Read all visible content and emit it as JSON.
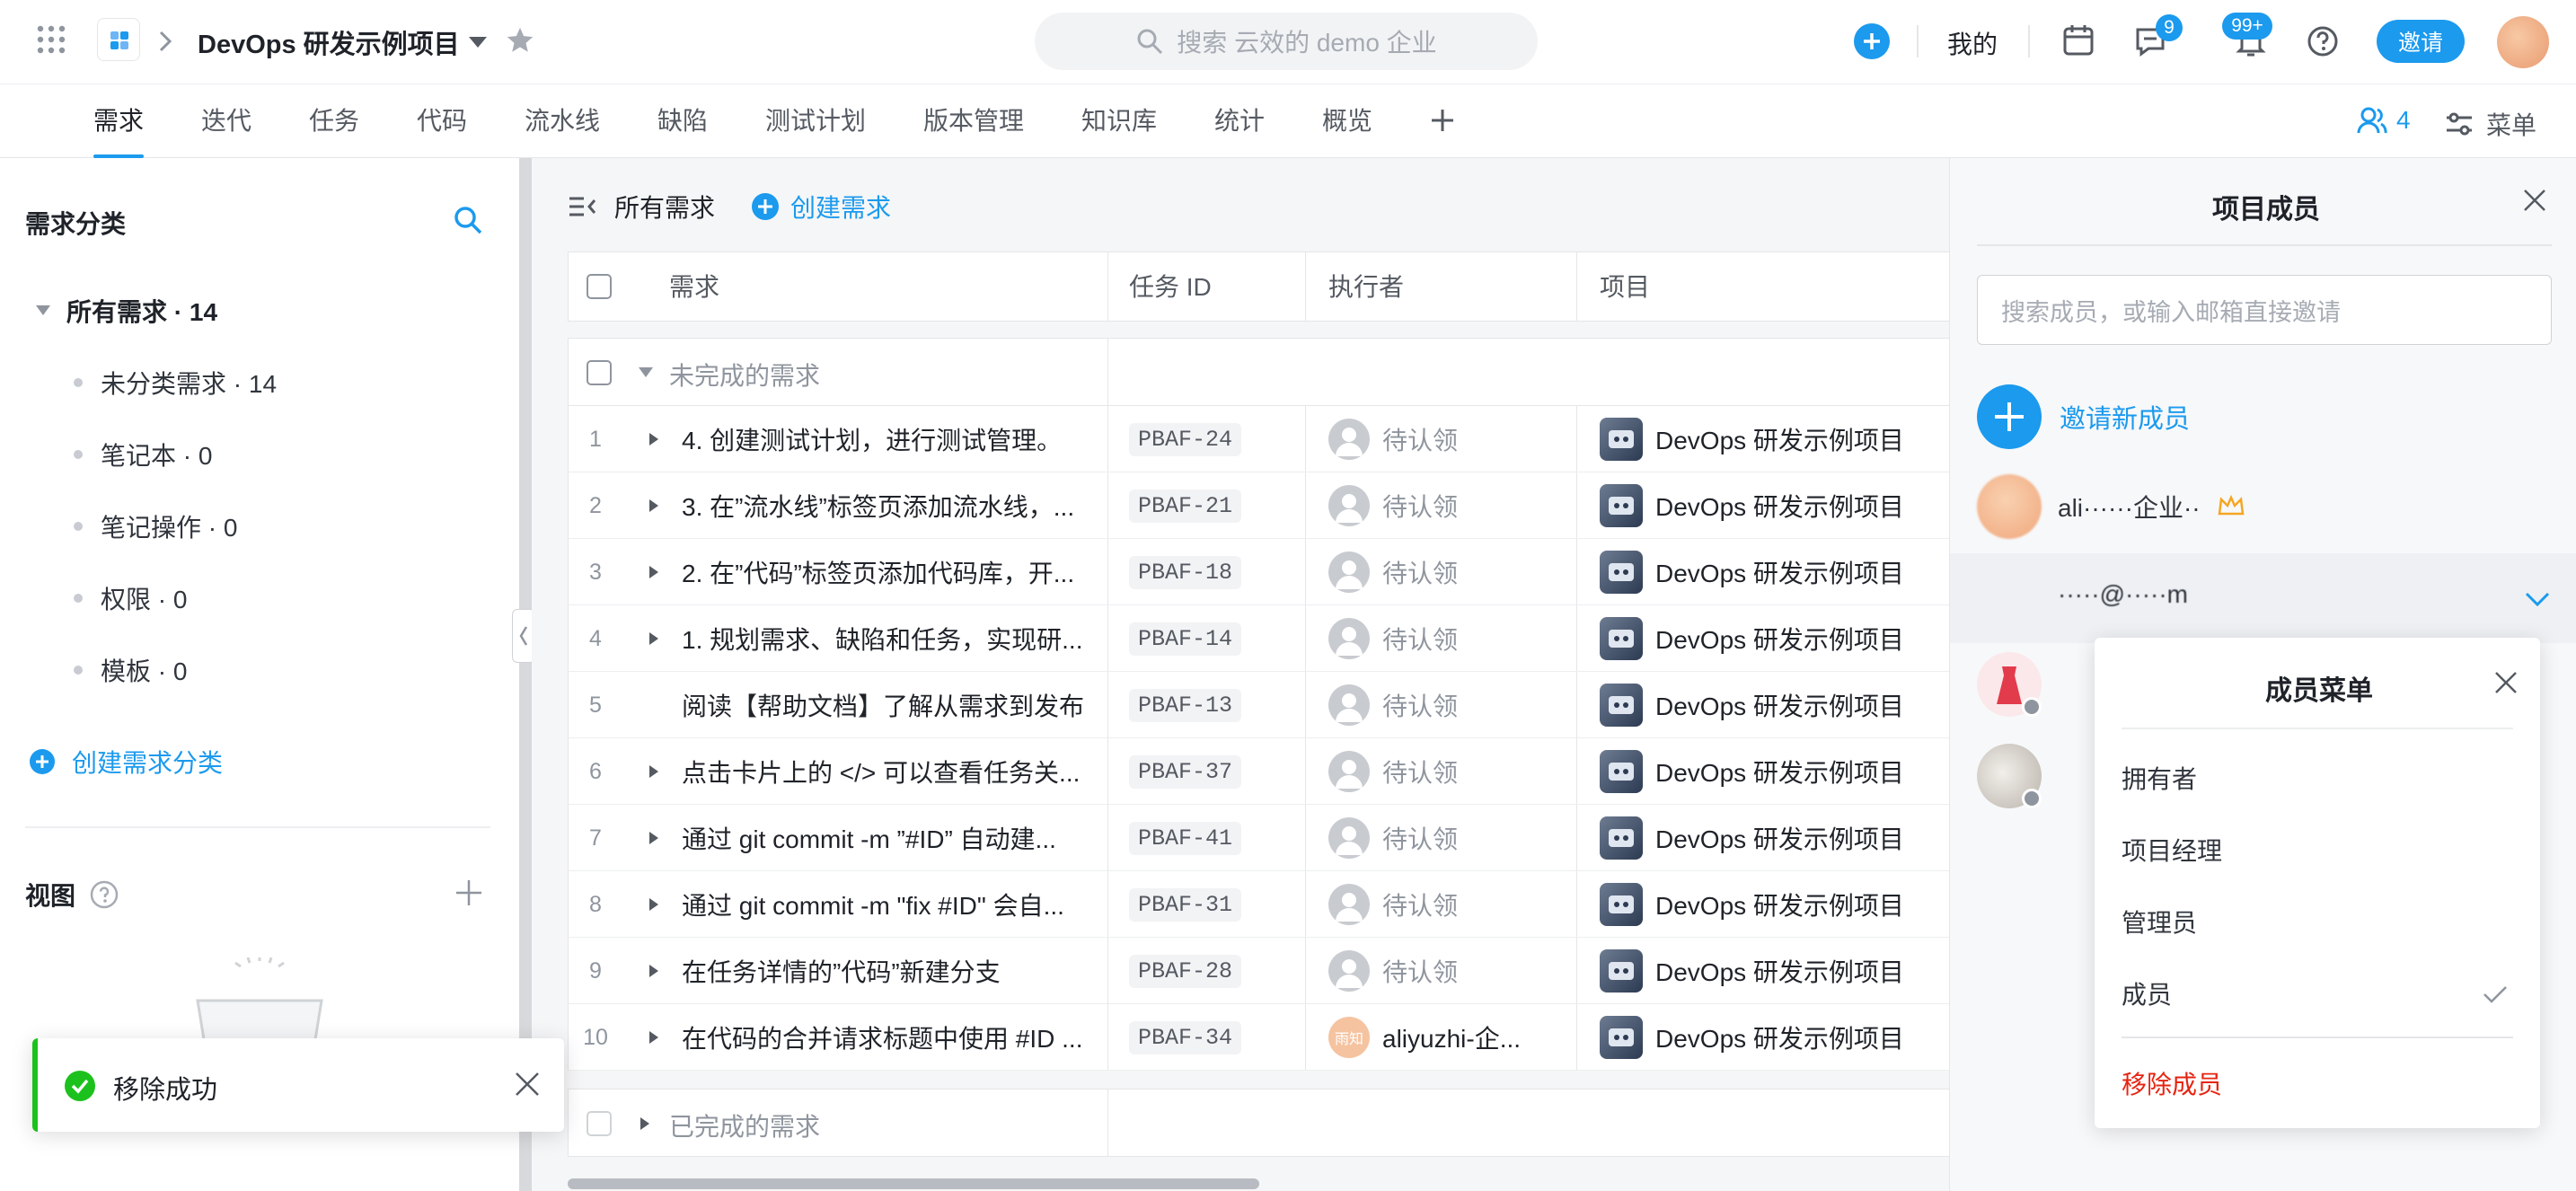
{
  "topbar": {
    "project_title": "DevOps 研发示例项目",
    "search_placeholder": "搜索 云效的 demo 企业",
    "mine_label": "我的",
    "messages_badge": "9",
    "notifications_badge": "99+",
    "invite_label": "邀请"
  },
  "tabs": [
    {
      "label": "需求"
    },
    {
      "label": "迭代"
    },
    {
      "label": "任务"
    },
    {
      "label": "代码"
    },
    {
      "label": "流水线"
    },
    {
      "label": "缺陷"
    },
    {
      "label": "测试计划"
    },
    {
      "label": "版本管理"
    },
    {
      "label": "知识库"
    },
    {
      "label": "统计"
    },
    {
      "label": "概览"
    }
  ],
  "tabbar_right": {
    "member_count": "4",
    "menu_label": "菜单"
  },
  "sidebar": {
    "title": "需求分类",
    "all_item": "所有需求 · 14",
    "items": [
      {
        "label": "未分类需求 · 14"
      },
      {
        "label": "笔记本 · 0"
      },
      {
        "label": "笔记操作 · 0"
      },
      {
        "label": "权限 · 0"
      },
      {
        "label": "模板 · 0"
      }
    ],
    "create_category": "创建需求分类",
    "view_title": "视图"
  },
  "main": {
    "breadcrumb": "所有需求",
    "create_label": "创建需求",
    "columns": [
      "需求",
      "任务 ID",
      "执行者",
      "项目"
    ],
    "group_open": "未完成的需求",
    "group_done": "已完成的需求",
    "rows": [
      {
        "num": "1",
        "title": "4. 创建测试计划，进行测试管理。",
        "tid": "PBAF-24",
        "assignee": "待认领",
        "project": "DevOps 研发示例项目",
        "expand": true
      },
      {
        "num": "2",
        "title": "3. 在”流水线”标签页添加流水线，...",
        "tid": "PBAF-21",
        "assignee": "待认领",
        "project": "DevOps 研发示例项目",
        "expand": true
      },
      {
        "num": "3",
        "title": "2. 在”代码”标签页添加代码库，开...",
        "tid": "PBAF-18",
        "assignee": "待认领",
        "project": "DevOps 研发示例项目",
        "expand": true
      },
      {
        "num": "4",
        "title": "1. 规划需求、缺陷和任务，实现研...",
        "tid": "PBAF-14",
        "assignee": "待认领",
        "project": "DevOps 研发示例项目",
        "expand": true
      },
      {
        "num": "5",
        "title": "阅读【帮助文档】了解从需求到发布",
        "tid": "PBAF-13",
        "assignee": "待认领",
        "project": "DevOps 研发示例项目",
        "expand": false
      },
      {
        "num": "6",
        "title": "点击卡片上的 </> 可以查看任务关...",
        "tid": "PBAF-37",
        "assignee": "待认领",
        "project": "DevOps 研发示例项目",
        "expand": true
      },
      {
        "num": "7",
        "title": "通过 git commit -m ”#ID” 自动建...",
        "tid": "PBAF-41",
        "assignee": "待认领",
        "project": "DevOps 研发示例项目",
        "expand": true
      },
      {
        "num": "8",
        "title": "通过 git commit -m \"fix #ID\" 会自...",
        "tid": "PBAF-31",
        "assignee": "待认领",
        "project": "DevOps 研发示例项目",
        "expand": true
      },
      {
        "num": "9",
        "title": "在任务详情的”代码”新建分支",
        "tid": "PBAF-28",
        "assignee": "待认领",
        "project": "DevOps 研发示例项目",
        "expand": true
      },
      {
        "num": "10",
        "title": "在代码的合并请求标题中使用 #ID ...",
        "tid": "PBAF-34",
        "assignee": "aliyuzhi-企...",
        "project": "DevOps 研发示例项目",
        "expand": true
      }
    ],
    "assignee_avatar_text": "雨知"
  },
  "member_panel": {
    "title": "项目成员",
    "search_placeholder": "搜索成员，或输入邮箱直接邀请",
    "invite_new": "邀请新成员",
    "members": [
      {
        "name": "ali······企业··"
      },
      {
        "name": "·····@·····m"
      }
    ]
  },
  "member_menu": {
    "title": "成员菜单",
    "items": [
      {
        "label": "拥有者"
      },
      {
        "label": "项目经理"
      },
      {
        "label": "管理员"
      },
      {
        "label": "成员"
      }
    ],
    "remove_label": "移除成员"
  },
  "toast": {
    "message": "移除成功"
  },
  "colors": {
    "accent": "#1b9aee",
    "success": "#1dc11d",
    "danger": "#e62412"
  }
}
